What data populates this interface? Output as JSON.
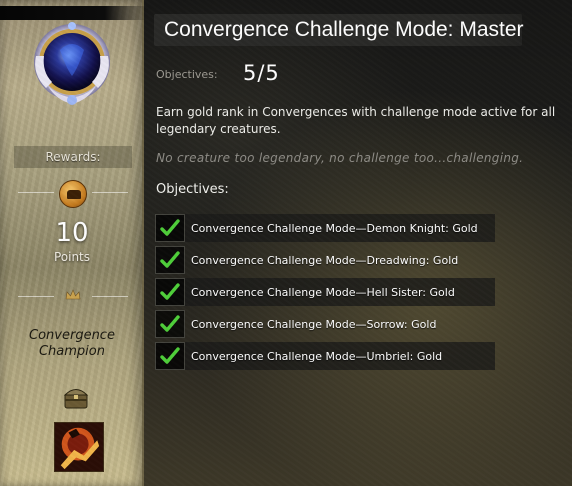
{
  "achievement": {
    "title": "Convergence Challenge Mode: Master",
    "objectives_label": "Objectives:",
    "objectives_count": "5/5",
    "description": "Earn gold rank in Convergences with challenge mode active for all legendary creatures.",
    "flavor_text": "No creature too legendary, no challenge too...challenging.",
    "objectives_header": "Objectives:",
    "objectives": [
      {
        "label": "Convergence Challenge Mode—Demon Knight: Gold",
        "completed": true
      },
      {
        "label": "Convergence Challenge Mode—Dreadwing: Gold",
        "completed": true
      },
      {
        "label": "Convergence Challenge Mode—Hell Sister: Gold",
        "completed": true
      },
      {
        "label": "Convergence Challenge Mode—Sorrow: Gold",
        "completed": true
      },
      {
        "label": "Convergence Challenge Mode—Umbriel: Gold",
        "completed": true
      }
    ]
  },
  "rewards": {
    "header": "Rewards:",
    "points_value": "10",
    "points_label": "Points",
    "title_reward_line1": "Convergence",
    "title_reward_line2": "Champion"
  },
  "icons": {
    "emblem": "achievement-emblem-icon",
    "points": "achievement-points-coin-icon",
    "title": "crown-icon",
    "chest": "chest-icon",
    "item": "reward-item-icon",
    "check": "checkmark-icon"
  },
  "colors": {
    "check_green": "#4fcf3a",
    "sidebar_gold": "#b9ae8b",
    "title_bar": "#2a2a28"
  }
}
